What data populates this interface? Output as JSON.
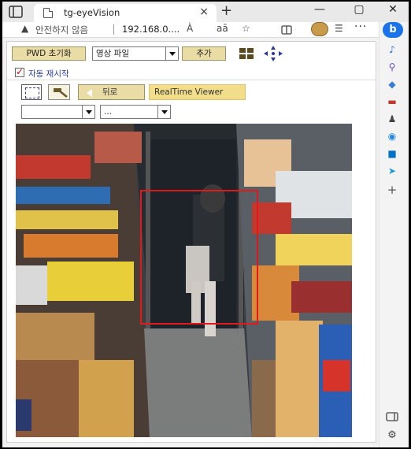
{
  "browser": {
    "tab_title": "tg-eyeVision",
    "close_tab": "×",
    "new_tab": "+",
    "security_label": "안전하지 않음",
    "url": "192.168.0....",
    "read_aloud": "À",
    "translate": "aā"
  },
  "toolbar": {
    "pwd_reset_label": "PWD 초기화",
    "source_select_value": "영상 파일",
    "add_label": "추가"
  },
  "auto_restart": {
    "checked": true,
    "label": "자동 재시작"
  },
  "nav": {
    "back_label": "뒤로",
    "realtime_label": "RealTime Viewer",
    "select1_value": "",
    "select2_value": "..."
  },
  "colors": {
    "button_olive": "#e9dca4",
    "roi_border": "#e01a1a",
    "realtime_button": "#f2dd8a"
  }
}
